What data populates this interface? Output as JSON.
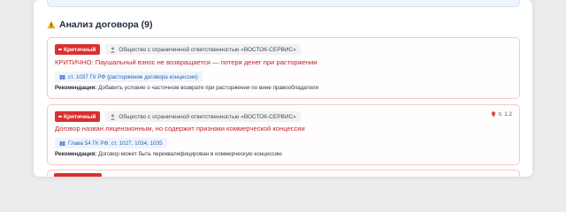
{
  "section": {
    "title": "Анализ договора (9)"
  },
  "issues": [
    {
      "severity": "Критичный",
      "party": "Общество с ограниченной ответственностью «ВОСТОК-СЕРВИС»",
      "title": "КРИТИЧНО: Паушальный взнос не возвращается — потеря денег при расторжении",
      "law_ref": "ст. 1037 ГК РФ (расторжение договора концессии)",
      "rec_label": "Рекомендация:",
      "rec_text": "Добавить условие о частичном возврате при расторжении по вине правообладателя",
      "location": ""
    },
    {
      "severity": "Критичный",
      "party": "Общество с ограниченной ответственностью «ВОСТОК-СЕРВИС»",
      "title": "Договор назван лицензионным, но содержит признаки коммерческой концессии",
      "law_ref": "Глава 54 ГК РФ, ст. 1027, 1034, 1035",
      "rec_label": "Рекомендация:",
      "rec_text": "Договор может быть переквалифицирован в коммерческую концессию",
      "location": "п. 1.2"
    }
  ],
  "colors": {
    "critical": "#d93030",
    "title_red": "#c0262d",
    "law_blue": "#2a64b8",
    "warning_yellow": "#f2b01e"
  }
}
